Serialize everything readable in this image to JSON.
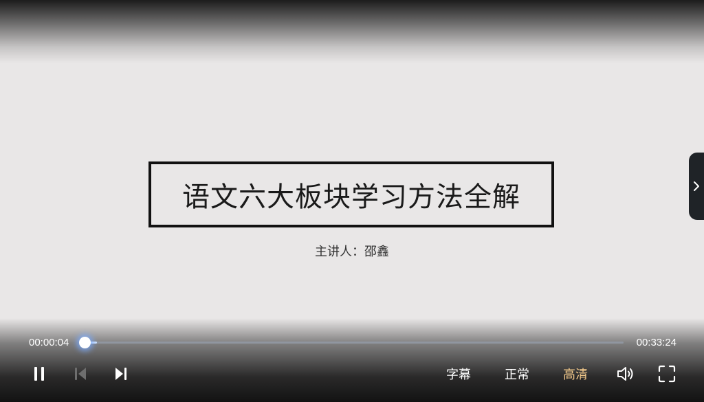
{
  "video": {
    "slide_title": "语文六大板块学习方法全解",
    "presenter": "主讲人：邵鑫"
  },
  "controls": {
    "current_time": "00:00:04",
    "total_time": "00:33:24",
    "progress_fraction": 0.002,
    "subtitle_label": "字幕",
    "speed_label": "正常",
    "quality_label": "高清",
    "icons": {
      "pause": "pause-icon",
      "previous": "skip-previous-icon",
      "next": "skip-next-icon",
      "volume": "volume-icon",
      "fullscreen": "fullscreen-icon",
      "side_tab": "chevron-right-icon"
    }
  },
  "colors": {
    "accent_quality": "#f3c98b",
    "progress_knob_glow": "#78aaff",
    "slide_background": "#e9e7e7"
  }
}
